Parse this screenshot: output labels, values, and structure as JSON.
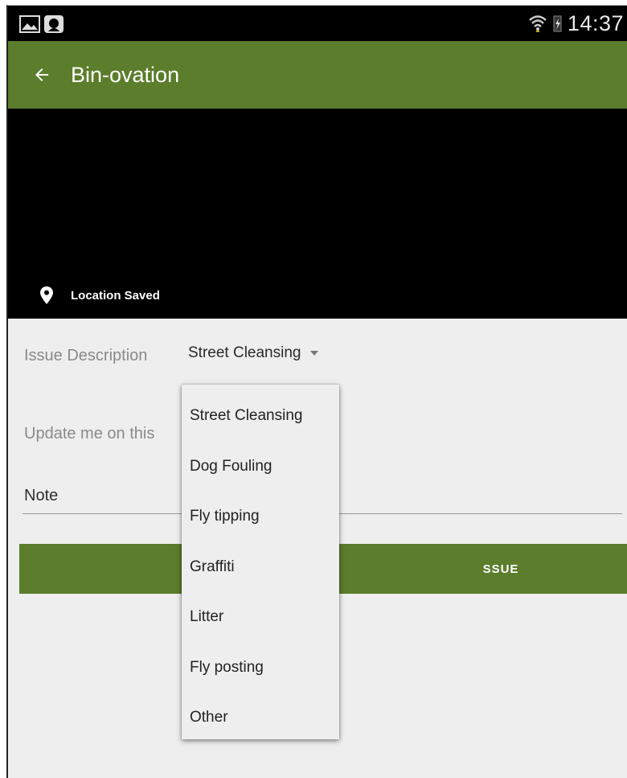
{
  "status_bar": {
    "time": "14:37",
    "icons": [
      "gallery-icon",
      "app-notification-icon",
      "wifi-icon",
      "battery-charging-icon"
    ]
  },
  "toolbar": {
    "title": "Bin-ovation",
    "back_icon": "arrow-left-icon"
  },
  "preview": {
    "location_text": "Location Saved",
    "location_icon": "map-pin-icon"
  },
  "form": {
    "issue_label": "Issue Description",
    "issue_selected": "Street Cleansing",
    "update_label": "Update me on this",
    "note_value": "Note",
    "submit_label_visible": "SSUE"
  },
  "dropdown": {
    "options": [
      "Street Cleansing",
      "Dog Fouling",
      "Fly tipping",
      "Graffiti",
      "Litter",
      "Fly posting",
      "Other"
    ]
  },
  "colors": {
    "accent": "#5b7d2c",
    "background": "#eeeeee",
    "status_bar": "#000000"
  }
}
